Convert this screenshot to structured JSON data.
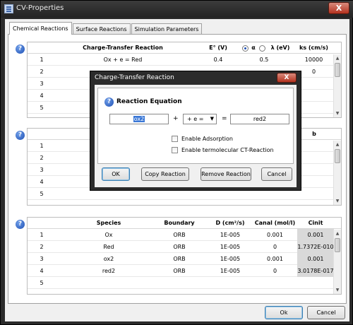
{
  "window": {
    "title": "CV-Properties",
    "close_glyph": "X"
  },
  "tabs": [
    "Chemical Reactions",
    "Surface Reactions",
    "Simulation Parameters"
  ],
  "help_glyph": "?",
  "ct_table": {
    "headers": {
      "reaction": "Charge-Transfer Reaction",
      "e0": "E° (V)",
      "alpha": "α",
      "lambda": "λ  (eV)",
      "ks": "ks (cm/s)"
    },
    "rows": [
      {
        "num": "1",
        "reaction": "Ox + e = Red",
        "e0": "0.4",
        "alpha": "0.5",
        "ks": "10000"
      },
      {
        "num": "2",
        "reaction": "",
        "e0": "",
        "alpha": "",
        "ks": "0"
      },
      {
        "num": "3",
        "reaction": "",
        "e0": "",
        "alpha": "",
        "ks": ""
      },
      {
        "num": "4",
        "reaction": "",
        "e0": "",
        "alpha": "",
        "ks": ""
      },
      {
        "num": "5",
        "reaction": "",
        "e0": "",
        "alpha": "",
        "ks": ""
      }
    ]
  },
  "chem_table": {
    "header_partial": "b",
    "rows": [
      "1",
      "2",
      "3",
      "4",
      "5"
    ]
  },
  "species_table": {
    "headers": {
      "species": "Species",
      "boundary": "Boundary",
      "d": "D (cm²/s)",
      "canal": "Canal (mol/l)",
      "cinit": "Cinit (mol/l)"
    },
    "rows": [
      {
        "num": "1",
        "species": "Ox",
        "boundary": "ORB",
        "d": "1E-005",
        "canal": "0.001",
        "cinit": "0.001"
      },
      {
        "num": "2",
        "species": "Red",
        "boundary": "ORB",
        "d": "1E-005",
        "canal": "0",
        "cinit": "1.7372E-010"
      },
      {
        "num": "3",
        "species": "ox2",
        "boundary": "ORB",
        "d": "1E-005",
        "canal": "0.001",
        "cinit": "0.001"
      },
      {
        "num": "4",
        "species": "red2",
        "boundary": "ORB",
        "d": "1E-005",
        "canal": "0",
        "cinit": "3.0178E-017"
      },
      {
        "num": "5",
        "species": "",
        "boundary": "",
        "d": "",
        "canal": "",
        "cinit": ""
      }
    ]
  },
  "buttons": {
    "ok": "Ok",
    "cancel": "Cancel"
  },
  "dialog": {
    "title": "Charge-Transfer Reaction",
    "close_glyph": "X",
    "section_label": "Reaction Equation",
    "left_species": "ox2",
    "plus": "+",
    "electrons": "+ e =",
    "equals": "=",
    "right_species": "red2",
    "checkbox_adsorption": "Enable Adsorption",
    "checkbox_termolecular": "Enable termolecular CT-Reaction",
    "buttons": {
      "ok": "OK",
      "copy": "Copy Reaction",
      "remove": "Remove Reaction",
      "cancel": "Cancel"
    }
  }
}
